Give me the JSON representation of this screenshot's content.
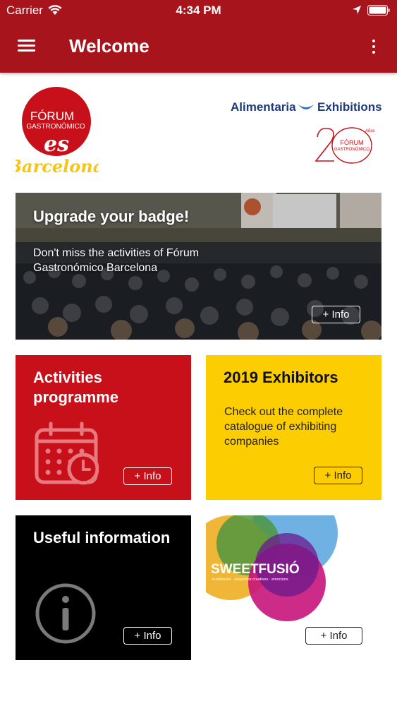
{
  "status_bar": {
    "carrier": "Carrier",
    "time": "4:34 PM",
    "icons": [
      "wifi-icon",
      "location-arrow-icon",
      "battery-icon"
    ]
  },
  "app_bar": {
    "title": "Welcome",
    "menu_icon": "hamburger-menu-icon",
    "more_icon": "more-vertical-icon",
    "color": "#a7141b"
  },
  "logos": {
    "forum_line1": "FÓRUM",
    "forum_line2": "GASTRONÓMICO",
    "forum_es": "es",
    "forum_city": "Barcelona",
    "alimentaria": "Alimentaria",
    "exhibitions": "Exhibitions",
    "twenty_small": "Años",
    "twenty_line1": "FÓRUM",
    "twenty_line2": "GASTRONÓMICO"
  },
  "banner": {
    "title": "Upgrade your badge!",
    "text": "Don't miss the activities of Fórum Gastronómico Barcelona",
    "button": "+ Info"
  },
  "cards": {
    "activities": {
      "title": "Activities programme",
      "icon": "calendar-clock-icon",
      "button": "+ Info",
      "color": "#c8101a"
    },
    "exhibitors": {
      "title": "2019 Exhibitors",
      "text": "Check out the complete catalogue of exhibiting companies",
      "button": "+ Info",
      "color": "#fccd00"
    },
    "useful": {
      "title": "Useful information",
      "icon": "info-circle-icon",
      "button": "+ Info",
      "color": "#000000"
    },
    "sweetfusio": {
      "logo_text": "SWEETFUSIÓ",
      "tagline": "tendències · propostes creatives · emocions",
      "button": "+ Info"
    }
  }
}
